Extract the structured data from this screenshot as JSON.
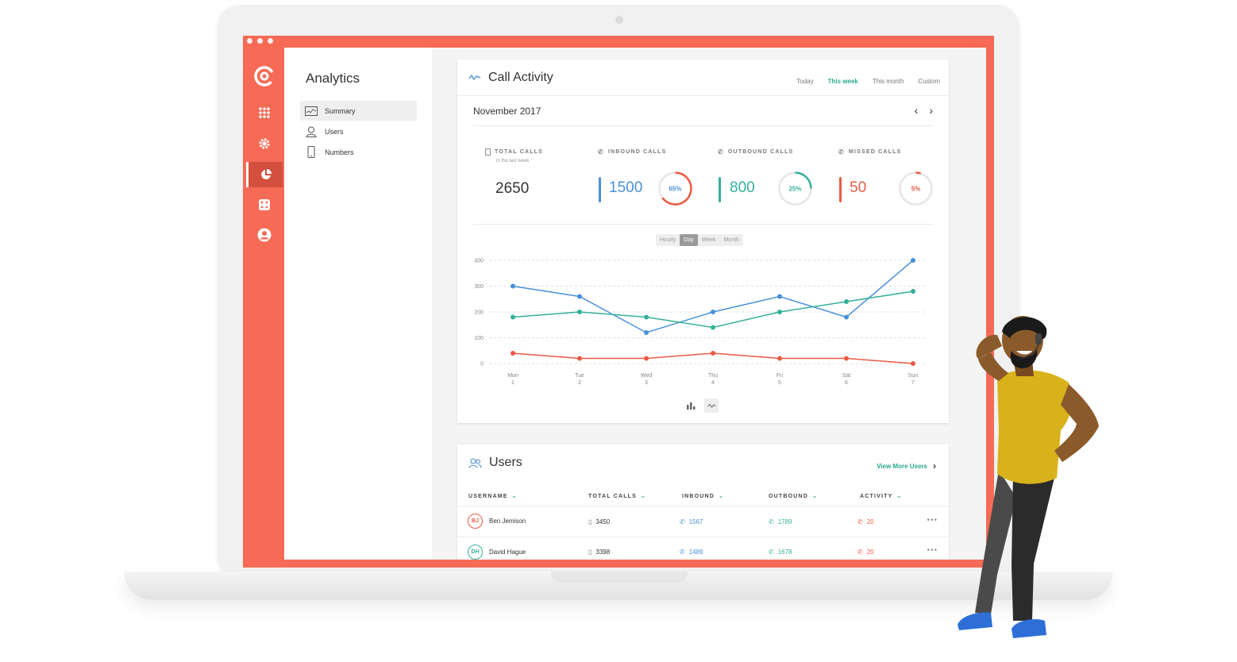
{
  "colors": {
    "brand": "#f66a56",
    "inbound": "#4a90d9",
    "outbound": "#35b09a",
    "missed": "#ea5a45",
    "accent": "#2aa894"
  },
  "rail": {
    "icons": [
      "logo-icon",
      "grid-icon",
      "gear-icon",
      "pie-chart-icon",
      "dice-icon",
      "user-icon"
    ],
    "active": "pie-chart-icon"
  },
  "sidebar": {
    "title": "Analytics",
    "items": [
      {
        "label": "Summary",
        "icon": "chart-icon",
        "active": true
      },
      {
        "label": "Users",
        "icon": "person-icon",
        "active": false
      },
      {
        "label": "Numbers",
        "icon": "phone-icon",
        "active": false
      }
    ]
  },
  "call_activity": {
    "title": "Call Activity",
    "ranges": [
      "Today",
      "This week",
      "This month",
      "Custom"
    ],
    "active_range": "This week",
    "month": "November 2017",
    "stats": {
      "total": {
        "label": "TOTAL CALLS",
        "sub": "in the last week",
        "value": "2650"
      },
      "inbound": {
        "label": "INBOUND CALLS",
        "value": "1500",
        "percent": "65%",
        "fraction": 0.65
      },
      "outbound": {
        "label": "OUTBOUND CALLS",
        "value": "800",
        "percent": "25%",
        "fraction": 0.25
      },
      "missed": {
        "label": "MISSED CALLS",
        "value": "50",
        "percent": "5%",
        "fraction": 0.05
      }
    },
    "granularity": [
      "Hourly",
      "Day",
      "Week",
      "Month"
    ],
    "active_granularity": "Day"
  },
  "chart_data": {
    "type": "line",
    "categories": [
      "Mon",
      "Tue",
      "Wed",
      "Thu",
      "Fri",
      "Sat",
      "Sun"
    ],
    "category_sub": [
      "1",
      "2",
      "3",
      "4",
      "5",
      "6",
      "7"
    ],
    "yticks": [
      0,
      100,
      200,
      300,
      400
    ],
    "ylim": [
      0,
      400
    ],
    "grid": true,
    "series": [
      {
        "color": "#4a90d9",
        "values": [
          300,
          260,
          120,
          200,
          260,
          180,
          400
        ]
      },
      {
        "color": "#35b09a",
        "values": [
          180,
          200,
          180,
          140,
          200,
          240,
          280
        ]
      },
      {
        "color": "#ea5a45",
        "values": [
          40,
          20,
          20,
          40,
          20,
          20,
          0
        ]
      }
    ]
  },
  "users": {
    "title": "Users",
    "view_more": "View More Users",
    "columns": [
      "USERNAME",
      "TOTAL CALLS",
      "INBOUND",
      "OUTBOUND",
      "ACTIVITY"
    ],
    "rows": [
      {
        "initials": "BJ",
        "name": "Ben Jemison",
        "total": "3450",
        "inbound": "1567",
        "outbound": "1789",
        "activity": "20",
        "avatar_color": "#ea5a45"
      },
      {
        "initials": "DH",
        "name": "David Hague",
        "total": "3398",
        "inbound": "1489",
        "outbound": "1678",
        "activity": "20",
        "avatar_color": "#35b09a"
      }
    ]
  }
}
